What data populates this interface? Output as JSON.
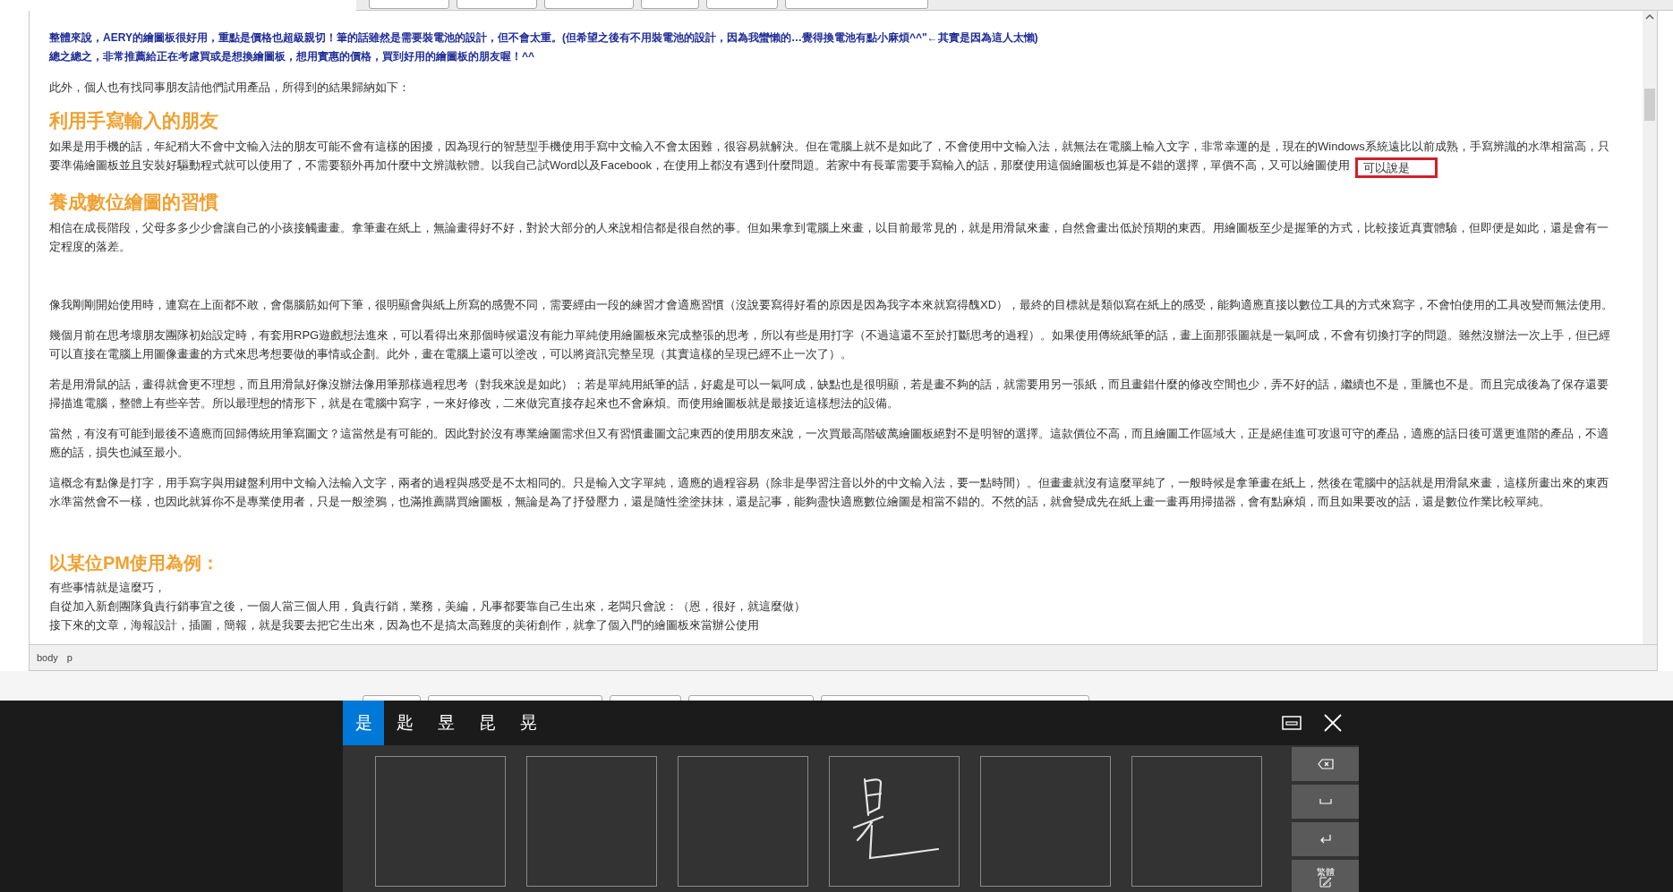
{
  "editor": {
    "blocks": [
      {
        "kind": "emphasis",
        "lines": [
          "整體來說，AERY的繪圖板很好用，重點是價格也超級親切！筆的話雖然是需要裝電池的設計，但不會太重。(但希望之後有不用裝電池的設計，因為我蠻懶的…覺得換電池有點小麻煩^^\"←其實是因為這人太懶)",
          "總之總之，非常推薦給正在考慮買或是想換繪圖板，想用實惠的價格，買到好用的繪圖板的朋友喔！^^"
        ]
      },
      {
        "kind": "paragraph",
        "text": "此外，個人也有找同事朋友請他們試用產品，所得到的結果歸納如下："
      },
      {
        "kind": "heading",
        "text": "利用手寫輸入的朋友"
      },
      {
        "kind": "paragraph",
        "text": "如果是用手機的話，年紀稍大不會中文輸入法的朋友可能不會有這樣的困擾，因為現行的智慧型手機使用手寫中文輸入不會太困難，很容易就解決。但在電腦上就不是如此了，不會使用中文輸入法，就無法在電腦上輸入文字，非常幸運的是，現在的Windows系統遠比以前成熟，手寫辨識的水準相當高，只要準備繪圖板並且安裝好驅動程式就可以使用了，不需要額外再加什麼中文辨識軟體。以我自己試Word以及Facebook，在使用上都沒有遇到什麼問題。若家中有長輩需要手寫輸入的話，那麼使用這個繪圖板也算是不錯的選擇，單價不高，又可以繪圖使用",
        "composition": "可以說是"
      },
      {
        "kind": "heading",
        "text": "養成數位繪圖的習慣"
      },
      {
        "kind": "paragraph",
        "text": "相信在成長階段，父母多多少少會讓自己的小孩接觸畫畫。拿筆畫在紙上，無論畫得好不好，對於大部分的人來說相信都是很自然的事。但如果拿到電腦上來畫，以目前最常見的，就是用滑鼠來畫，自然會畫出低於預期的東西。用繪圖板至少是握筆的方式，比較接近真實體驗，但即便是如此，還是會有一定程度的落差。"
      },
      {
        "kind": "blank"
      },
      {
        "kind": "paragraph",
        "text": "像我剛剛開始使用時，連寫在上面都不敢，會傷腦筋如何下筆，很明顯會與紙上所寫的感覺不同，需要經由一段的練習才會適應習慣（沒說要寫得好看的原因是因為我字本來就寫得醜XD），最終的目標就是類似寫在紙上的感受，能夠適應直接以數位工具的方式來寫字，不會怕使用的工具改變而無法使用。"
      },
      {
        "kind": "paragraph",
        "text": "幾個月前在思考壞朋友團隊初始設定時，有套用RPG遊戲想法進來，可以看得出來那個時候還沒有能力單純使用繪圖板來完成整張的思考，所以有些是用打字（不過這還不至於打斷思考的過程）。如果使用傳統紙筆的話，畫上面那張圖就是一氣呵成，不會有切換打字的問題。雖然沒辦法一次上手，但已經可以直接在電腦上用圖像畫畫的方式來思考想要做的事情或企劃。此外，畫在電腦上還可以塗改，可以將資訊完整呈現（其實這樣的呈現已經不止一次了）。"
      },
      {
        "kind": "paragraph",
        "text": "若是用滑鼠的話，畫得就會更不理想，而且用滑鼠好像沒辦法像用筆那樣過程思考（對我來說是如此）；若是單純用紙筆的話，好處是可以一氣呵成，缺點也是很明顯，若是畫不夠的話，就需要用另一張紙，而且畫錯什麼的修改空間也少，弄不好的話，繼續也不是，重騰也不是。而且完成後為了保存還要掃描進電腦，整體上有些辛苦。所以最理想的情形下，就是在電腦中寫字，一來好修改，二來做完直接存起來也不會麻煩。而使用繪圖板就是最接近這樣想法的設備。"
      },
      {
        "kind": "paragraph",
        "text": "當然，有沒有可能到最後不適應而回歸傳統用筆寫圖文？這當然是有可能的。因此對於沒有專業繪圖需求但又有習慣畫圖文記東西的使用朋友來說，一次買最高階破萬繪圖板絕對不是明智的選擇。這款價位不高，而且繪圖工作區域大，正是絕佳進可攻退可守的產品，適應的話日後可選更進階的產品，不適應的話，損失也減至最小。"
      },
      {
        "kind": "paragraph",
        "text": "這概念有點像是打字，用手寫字與用鍵盤利用中文輸入法輸入文字，兩者的過程與感受是不太相同的。只是輸入文字單純，適應的過程容易（除非是學習注音以外的中文輸入法，要一點時間）。但畫畫就沒有這麼單純了，一般時候是拿筆畫在紙上，然後在電腦中的話就是用滑鼠來畫，這樣所畫出來的東西水準當然會不一樣，也因此就算你不是專業使用者，只是一般塗鴉，也滿推薦購買繪圖板，無論是為了抒發壓力，還是隨性塗塗抹抹，還是記事，能夠盡快適應數位繪圖是相當不錯的。不然的話，就會變成先在紙上畫一畫再用掃描器，會有點麻煩，而且如果要改的話，還是數位作業比較單純。"
      },
      {
        "kind": "blank"
      },
      {
        "kind": "subheading",
        "text": "以某位PM使用為例："
      },
      {
        "kind": "lines",
        "lines": [
          "有些事情就是這麼巧，",
          "自從加入新創團隊負責行銷事宜之後，一個人當三個人用，負責行銷，業務，美編，凡事都要靠自己生出來，老闆只會說：（恩，很好，就這麼做）",
          "接下來的文章，海報設計，插圖，簡報，就是我要去把它生出來，因為也不是搞太高難度的美術創作，就拿了個入門的繪圖板來當辦公使用"
        ]
      }
    ],
    "status_path": [
      "body",
      "p"
    ]
  },
  "handwriting_panel": {
    "candidates": [
      {
        "text": "是",
        "selected": true
      },
      {
        "text": "匙",
        "selected": false
      },
      {
        "text": "昱",
        "selected": false
      },
      {
        "text": "昆",
        "selected": false
      },
      {
        "text": "晃",
        "selected": false
      }
    ],
    "keys": [
      {
        "kind": "backspace"
      },
      {
        "kind": "space"
      },
      {
        "kind": "enter"
      },
      {
        "kind": "script",
        "label": "繁體"
      }
    ]
  }
}
